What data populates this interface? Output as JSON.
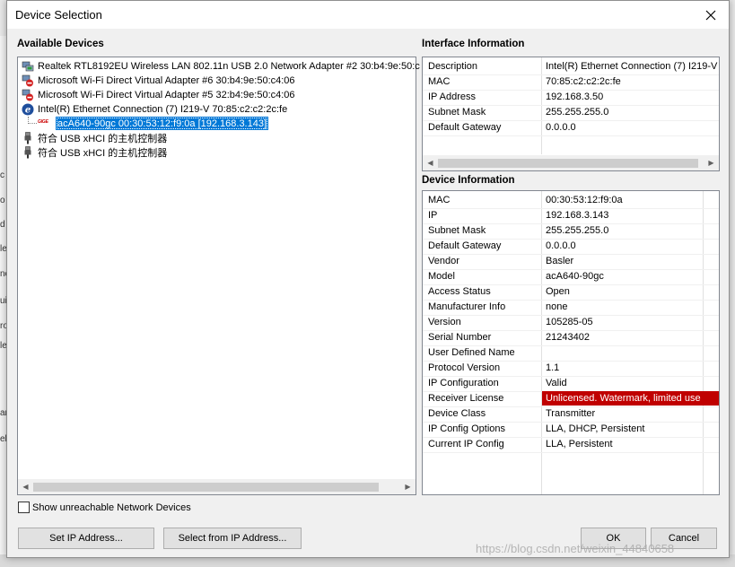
{
  "window": {
    "title": "Device Selection"
  },
  "background": {
    "edge_letters": [
      "c",
      "o",
      "d",
      "le",
      "ne",
      "ui",
      "ro",
      "le",
      "an",
      "el"
    ]
  },
  "available_devices": {
    "label": "Available Devices",
    "items": [
      {
        "icon": "network-adapter-icon",
        "label": "Realtek RTL8192EU Wireless LAN 802.11n USB 2.0 Network Adapter #2 30:b4:9e:50:c"
      },
      {
        "icon": "network-adapter-disabled-icon",
        "label": "Microsoft Wi-Fi Direct Virtual Adapter #6 30:b4:9e:50:c4:06"
      },
      {
        "icon": "network-adapter-disabled-icon",
        "label": "Microsoft Wi-Fi Direct Virtual Adapter #5 32:b4:9e:50:c4:06"
      },
      {
        "icon": "ethernet-adapter-icon",
        "label": "Intel(R) Ethernet Connection (7) I219-V 70:85:c2:c2:2c:fe"
      },
      {
        "icon": "usb-icon",
        "label": "符合 USB xHCI 的主机控制器"
      },
      {
        "icon": "usb-icon",
        "label": "符合 USB xHCI 的主机控制器"
      }
    ],
    "selected_camera": {
      "tag": "GIGE",
      "label": "acA640-90gc 00:30:53:12:f9:0a [192.168.3.143]"
    }
  },
  "interface_info": {
    "label": "Interface Information",
    "rows": [
      {
        "k": "Description",
        "v": "Intel(R) Ethernet Connection (7) I219-V"
      },
      {
        "k": "MAC",
        "v": "70:85:c2:c2:2c:fe"
      },
      {
        "k": "IP Address",
        "v": "192.168.3.50"
      },
      {
        "k": "Subnet Mask",
        "v": "255.255.255.0"
      },
      {
        "k": "Default Gateway",
        "v": "0.0.0.0"
      }
    ]
  },
  "device_info": {
    "label": "Device Information",
    "rows": [
      {
        "k": "MAC",
        "v": "00:30:53:12:f9:0a"
      },
      {
        "k": "IP",
        "v": "192.168.3.143"
      },
      {
        "k": "Subnet Mask",
        "v": "255.255.255.0"
      },
      {
        "k": "Default Gateway",
        "v": "0.0.0.0"
      },
      {
        "k": "Vendor",
        "v": "Basler"
      },
      {
        "k": "Model",
        "v": "acA640-90gc"
      },
      {
        "k": "Access Status",
        "v": "Open"
      },
      {
        "k": "Manufacturer Info",
        "v": "none"
      },
      {
        "k": "Version",
        "v": "105285-05"
      },
      {
        "k": "Serial Number",
        "v": "21243402"
      },
      {
        "k": "User Defined Name",
        "v": ""
      },
      {
        "k": "Protocol Version",
        "v": "1.1"
      },
      {
        "k": "IP Configuration",
        "v": "Valid"
      },
      {
        "k": "Receiver License",
        "v": "Unlicensed. Watermark, limited use"
      },
      {
        "k": "Device Class",
        "v": "Transmitter"
      },
      {
        "k": "IP Config Options",
        "v": "LLA, DHCP, Persistent"
      },
      {
        "k": "Current IP Config",
        "v": "LLA, Persistent"
      }
    ]
  },
  "checkbox": {
    "label": "Show unreachable Network Devices",
    "checked": false
  },
  "buttons": {
    "set_ip": "Set IP Address...",
    "select_from_ip": "Select from IP Address...",
    "ok": "OK",
    "cancel": "Cancel"
  },
  "watermark": "https://blog.csdn.net/weixin_44840658",
  "colors": {
    "selection": "#0078d7",
    "license_warning": "#c00000"
  }
}
